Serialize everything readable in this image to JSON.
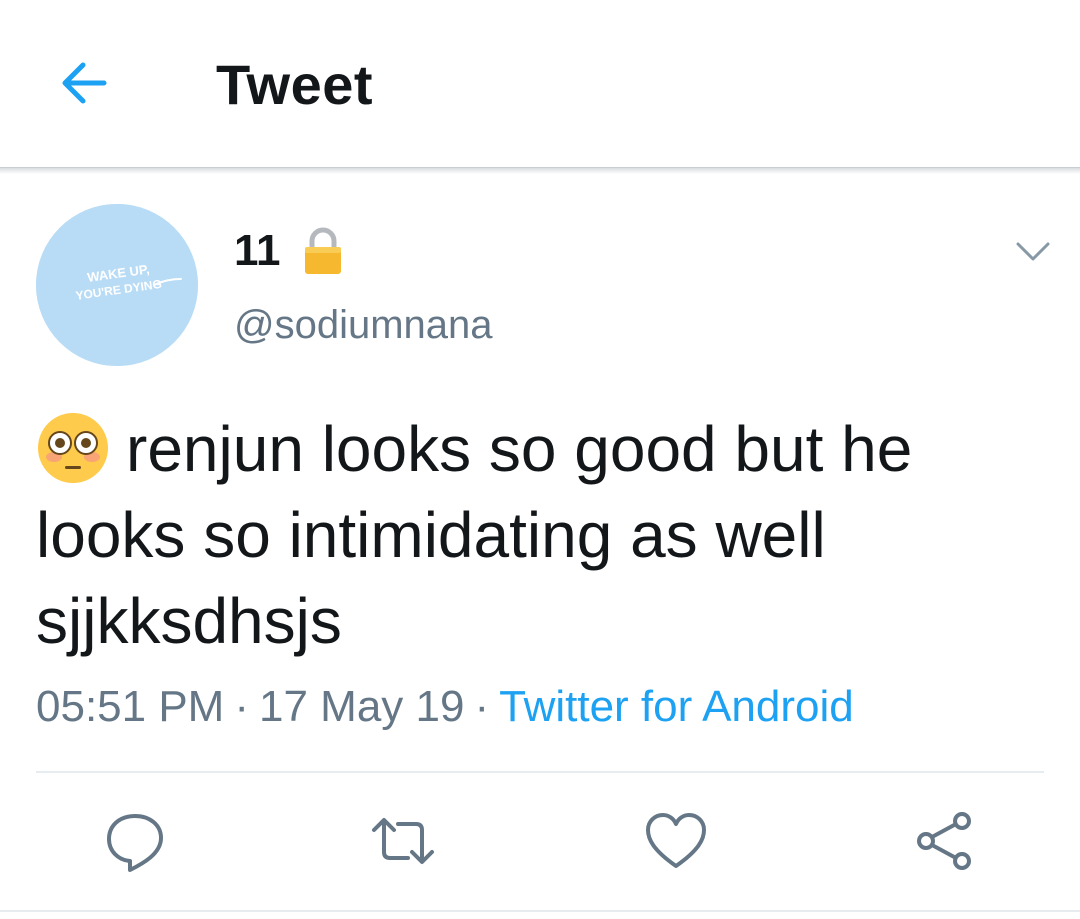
{
  "header": {
    "title": "Tweet",
    "back_icon": "arrow-left-icon"
  },
  "author": {
    "name": "11",
    "handle": "@sodiumnana",
    "protected_icon": "lock-icon",
    "avatar_text": [
      "WAKE UP,",
      "YOU'RE DYING"
    ],
    "avatar_color": "#b9dcf6"
  },
  "tweet": {
    "emoji_icon": "flushed-face-icon",
    "text": "renjun looks so good but he looks so intimidating as well sjjkksdhsjs"
  },
  "meta": {
    "time": "05:51 PM",
    "separator": "·",
    "date": "17 May 19",
    "source": "Twitter for Android"
  },
  "actions": [
    {
      "icon": "reply-icon"
    },
    {
      "icon": "retweet-icon"
    },
    {
      "icon": "heart-icon"
    },
    {
      "icon": "share-icon"
    }
  ],
  "colors": {
    "accent": "#1da1f2",
    "text": "#14171a",
    "secondary": "#657786"
  }
}
